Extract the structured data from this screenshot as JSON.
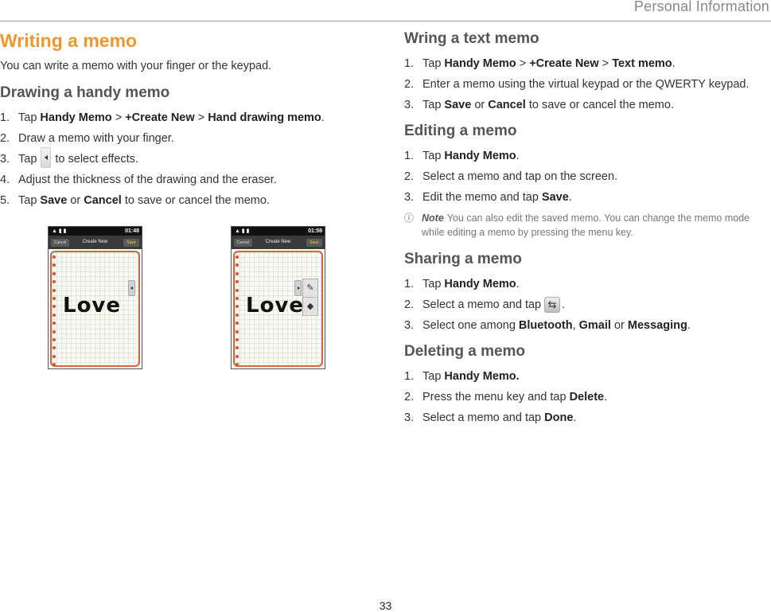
{
  "header": {
    "title": "Personal Information"
  },
  "page_number": "33",
  "left": {
    "title": "Writing a memo",
    "intro": "You can write a memo with your finger or the keypad.",
    "handy": {
      "heading": "Drawing a handy memo",
      "steps": [
        {
          "num": "1.",
          "pre": "Tap ",
          "b1": "Handy Memo",
          "s1": " > ",
          "b2": "+Create New",
          "s2": " > ",
          "b3": "Hand drawing memo",
          "post": "."
        },
        {
          "num": "2.",
          "text": "Draw a memo with your finger."
        },
        {
          "num": "3.",
          "pre": "Tap",
          "post": "to select effects."
        },
        {
          "num": "4.",
          "text": "Adjust the thickness of the drawing and the eraser."
        },
        {
          "num": "5.",
          "pre": "Tap ",
          "b1": "Save",
          "s1": " or ",
          "b2": "Cancel",
          "post": " to save or cancel the memo."
        }
      ]
    },
    "screens": [
      {
        "time": "01:48",
        "cancel": "Cancel",
        "title": "Create New",
        "save": "Save",
        "drawing": "Love"
      },
      {
        "time": "01:58",
        "cancel": "Cancel",
        "title": "Create New",
        "save": "Save",
        "drawing": "Love"
      }
    ]
  },
  "right": {
    "text_memo": {
      "heading": "Wring a text memo",
      "steps": [
        {
          "num": "1.",
          "pre": "Tap ",
          "b1": "Handy Memo",
          "s1": " > ",
          "b2": "+Create New",
          "s2": " > ",
          "b3": "Text memo",
          "post": "."
        },
        {
          "num": "2.",
          "text": "Enter a memo using the virtual keypad or the QWERTY keypad."
        },
        {
          "num": "3.",
          "pre": "Tap ",
          "b1": "Save",
          "s1": " or ",
          "b2": "Cancel",
          "post": " to save or cancel the memo."
        }
      ]
    },
    "editing": {
      "heading": "Editing a memo",
      "steps": [
        {
          "num": "1.",
          "pre": "Tap ",
          "b1": "Handy Memo",
          "post": "."
        },
        {
          "num": "2.",
          "text": "Select a memo and tap on the screen."
        },
        {
          "num": "3.",
          "pre": "Edit the memo and tap ",
          "b1": "Save",
          "post": "."
        }
      ],
      "note_icon": "ⓘ",
      "note_label": "Note",
      "note_text": "You can also edit the saved memo. You can change the memo mode while editing a memo by pressing the menu key."
    },
    "sharing": {
      "heading": "Sharing a memo",
      "steps": [
        {
          "num": "1.",
          "pre": "Tap ",
          "b1": "Handy Memo",
          "post": "."
        },
        {
          "num": "2.",
          "pre": "Select a memo and tap",
          "post": "."
        },
        {
          "num": "3.",
          "pre": "Select one among ",
          "b1": "Bluetooth",
          "s1": ", ",
          "b2": "Gmail",
          "s2": " or ",
          "b3": "Messaging",
          "post": "."
        }
      ]
    },
    "deleting": {
      "heading": "Deleting a memo",
      "steps": [
        {
          "num": "1.",
          "pre": "Tap ",
          "b1": "Handy Memo."
        },
        {
          "num": "2.",
          "pre": "Press the menu key and tap ",
          "b1": "Delete",
          "post": "."
        },
        {
          "num": "3.",
          "pre": "Select a memo and tap ",
          "b1": "Done",
          "post": "."
        }
      ]
    }
  },
  "icons": {
    "collapse_arrow": "collapse-arrow-icon",
    "sync": "sync-icon",
    "pen": "pen-icon",
    "eraser": "eraser-icon",
    "info": "info-icon"
  },
  "colors": {
    "title_accent": "#f0962c",
    "memo_border": "#d9623a"
  }
}
